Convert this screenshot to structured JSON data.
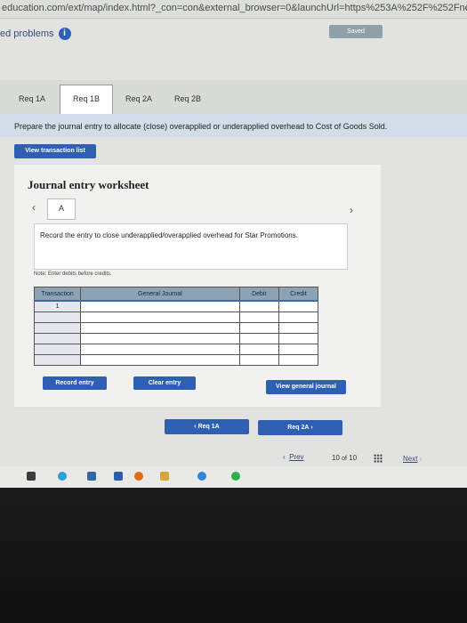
{
  "browser": {
    "url": "education.com/ext/map/index.html?_con=con&external_browser=0&launchUrl=https%253A%252F%252Fnewconnec"
  },
  "header": {
    "problems_label": "ed problems",
    "saved_label": "Saved"
  },
  "tabs": [
    {
      "label": "Req 1A"
    },
    {
      "label": "Req 1B"
    },
    {
      "label": "Req 2A"
    },
    {
      "label": "Req 2B"
    }
  ],
  "instruction": "Prepare the journal entry to allocate (close) overapplied or underapplied overhead to Cost of Goods Sold.",
  "view_transaction_list": "View transaction list",
  "worksheet": {
    "title": "Journal entry worksheet",
    "tab_label": "A",
    "record_text": "Record the entry to close underapplied/overapplied overhead for Star Promotions.",
    "note": "Note: Enter debits before credits.",
    "columns": [
      "Transaction",
      "General Journal",
      "Debit",
      "Credit"
    ],
    "rows": [
      {
        "transaction": "1"
      },
      {
        "transaction": ""
      },
      {
        "transaction": ""
      },
      {
        "transaction": ""
      },
      {
        "transaction": ""
      },
      {
        "transaction": ""
      }
    ],
    "record_entry": "Record entry",
    "clear_entry": "Clear entry",
    "view_general_journal": "View general journal"
  },
  "nav": {
    "prev_req": "Req 1A",
    "next_req": "Req 2A",
    "prev": "Prev",
    "page_current": "10",
    "page_of": "of",
    "page_total": "10",
    "next": "Next"
  },
  "colors": {
    "accent": "#2f5fb3",
    "header_bar": "#d3dde8",
    "table_header": "#8da2b3"
  }
}
